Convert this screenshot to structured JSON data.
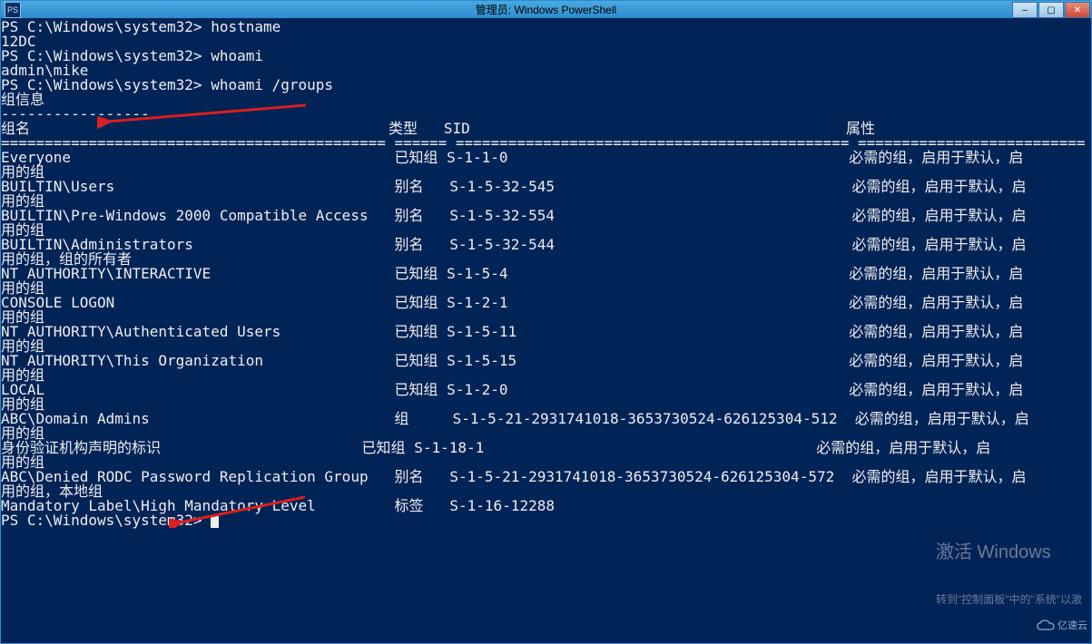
{
  "titlebar": {
    "icon_label": "PS",
    "title": "管理员: Windows PowerShell",
    "min": "–",
    "max": "▢",
    "close": "✕"
  },
  "prompt": "PS C:\\Windows\\system32> ",
  "commands": {
    "hostname_cmd": "hostname",
    "hostname_out": "12DC",
    "whoami_cmd": "whoami",
    "whoami_out": "admin\\mike",
    "whoami_groups_cmd": "whoami /groups"
  },
  "groups_header": {
    "title": "组信息",
    "underline": "-----------------"
  },
  "columns": {
    "name": "组名",
    "type": "类型",
    "sid": "SID",
    "attrs": "属性"
  },
  "col_underline": {
    "name": "============================================",
    "type": "======",
    "sid": "=============================================",
    "attrs": "=========================="
  },
  "rows": [
    {
      "name": "Everyone",
      "type": "已知组",
      "sid": "S-1-1-0",
      "attr": "必需的组，启用于默认，启",
      "attr2": "用的组"
    },
    {
      "name": "BUILTIN\\Users",
      "type": "别名",
      "sid": "S-1-5-32-545",
      "attr": "必需的组，启用于默认，启",
      "attr2": "用的组"
    },
    {
      "name": "BUILTIN\\Pre-Windows 2000 Compatible Access",
      "type": "别名",
      "sid": "S-1-5-32-554",
      "attr": "必需的组，启用于默认，启",
      "attr2": "用的组"
    },
    {
      "name": "BUILTIN\\Administrators",
      "type": "别名",
      "sid": "S-1-5-32-544",
      "attr": "必需的组，启用于默认，启",
      "attr2": "用的组，组的所有者"
    },
    {
      "name": "NT AUTHORITY\\INTERACTIVE",
      "type": "已知组",
      "sid": "S-1-5-4",
      "attr": "必需的组，启用于默认，启",
      "attr2": "用的组"
    },
    {
      "name": "CONSOLE LOGON",
      "type": "已知组",
      "sid": "S-1-2-1",
      "attr": "必需的组，启用于默认，启",
      "attr2": "用的组"
    },
    {
      "name": "NT AUTHORITY\\Authenticated Users",
      "type": "已知组",
      "sid": "S-1-5-11",
      "attr": "必需的组，启用于默认，启",
      "attr2": "用的组"
    },
    {
      "name": "NT AUTHORITY\\This Organization",
      "type": "已知组",
      "sid": "S-1-5-15",
      "attr": "必需的组，启用于默认，启",
      "attr2": "用的组"
    },
    {
      "name": "LOCAL",
      "type": "已知组",
      "sid": "S-1-2-0",
      "attr": "必需的组，启用于默认，启",
      "attr2": "用的组"
    },
    {
      "name": "ABC\\Domain Admins",
      "type": "组",
      "sid": "S-1-5-21-2931741018-3653730524-626125304-512",
      "attr": "必需的组，启用于默认，启",
      "attr2": "用的组"
    },
    {
      "name": "身份验证机构声明的标识",
      "type": "已知组",
      "sid": "S-1-18-1",
      "attr": "必需的组，启用于默认，启",
      "attr2": "用的组"
    },
    {
      "name": "ABC\\Denied RODC Password Replication Group",
      "type": "别名",
      "sid": "S-1-5-21-2931741018-3653730524-626125304-572",
      "attr": "必需的组，启用于默认，启",
      "attr2": "用的组，本地组"
    },
    {
      "name": "Mandatory Label\\High Mandatory Level",
      "type": "标签",
      "sid": "S-1-16-12288",
      "attr": "",
      "attr2": ""
    }
  ],
  "watermark": {
    "line1": "激活 Windows",
    "line2": "转到\"控制面板\"中的\"系统\"以激",
    "corner": "亿速云"
  }
}
